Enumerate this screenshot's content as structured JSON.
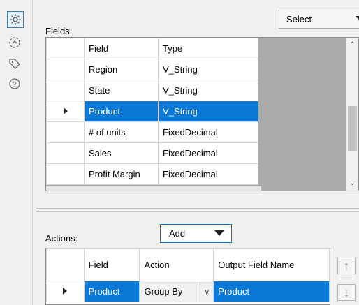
{
  "rail": {
    "icons": [
      "gear-icon",
      "circle-arrow-icon",
      "tag-icon",
      "help-icon"
    ]
  },
  "fields": {
    "label": "Fields:",
    "dropdown_value": "Select",
    "columns": [
      "Field",
      "Type"
    ],
    "rows": [
      {
        "field": "Region",
        "type": "V_String"
      },
      {
        "field": "State",
        "type": "V_String"
      },
      {
        "field": "Product",
        "type": "V_String"
      },
      {
        "field": "# of units",
        "type": "FixedDecimal"
      },
      {
        "field": "Sales",
        "type": "FixedDecimal"
      },
      {
        "field": "Profit Margin",
        "type": "FixedDecimal"
      }
    ],
    "selected_row": 2
  },
  "actions": {
    "label": "Actions:",
    "add_label": "Add",
    "columns": [
      "Field",
      "Action",
      "Output Field Name"
    ],
    "rows": [
      {
        "field": "Product",
        "action": "Group By",
        "output": "Product"
      }
    ]
  },
  "colors": {
    "selection": "#0a78d7",
    "accent_border": "#0078d7"
  }
}
